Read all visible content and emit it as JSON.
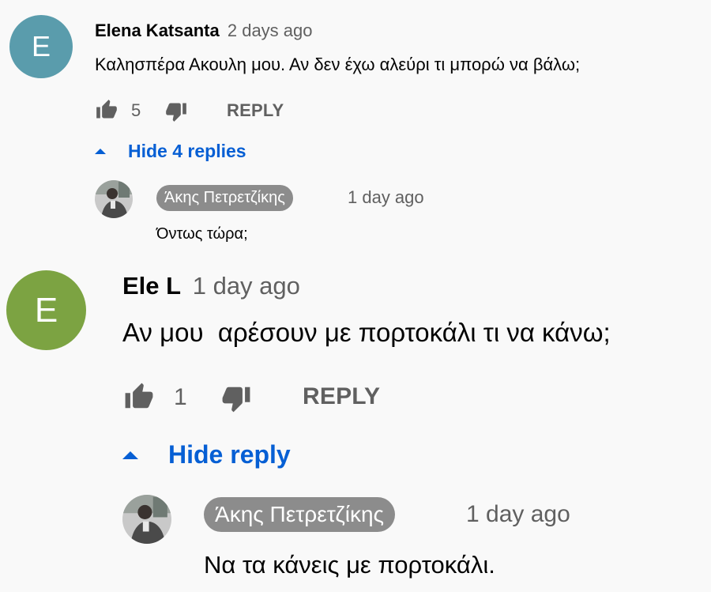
{
  "colors": {
    "avatar_teal": "#5a9cac",
    "avatar_green": "#7ca342",
    "author_chip": "#8c8c8c",
    "link_blue": "#065fd4",
    "meta_gray": "#606060"
  },
  "comments": [
    {
      "avatar_letter": "E",
      "author": "Elena Katsanta",
      "time": "2 days ago",
      "text": "Καλησπέρα Ακουλη μου. Αν δεν έχω αλεύρι τι μπορώ να βάλω;",
      "likes": "5",
      "reply_label": "REPLY",
      "toggle_label": "Hide 4 replies",
      "reply": {
        "author": "Άκης Πετρετζίκης",
        "time": "1 day ago",
        "text": "Όντως τώρα;"
      }
    },
    {
      "avatar_letter": "E",
      "author": "Ele L",
      "time": "1 day ago",
      "text": "Αν μου  αρέσουν με πορτοκάλι τι να κάνω;",
      "likes": "1",
      "reply_label": "REPLY",
      "toggle_label": "Hide reply",
      "reply": {
        "author": "Άκης Πετρετζίκης",
        "time": "1 day ago",
        "text": "Να τα κάνεις με πορτοκάλι."
      }
    }
  ],
  "icons": {
    "like": "thumb-up-icon",
    "dislike": "thumb-down-icon",
    "toggle": "caret-up-icon",
    "reply_avatar": "author-photo-avatar"
  }
}
